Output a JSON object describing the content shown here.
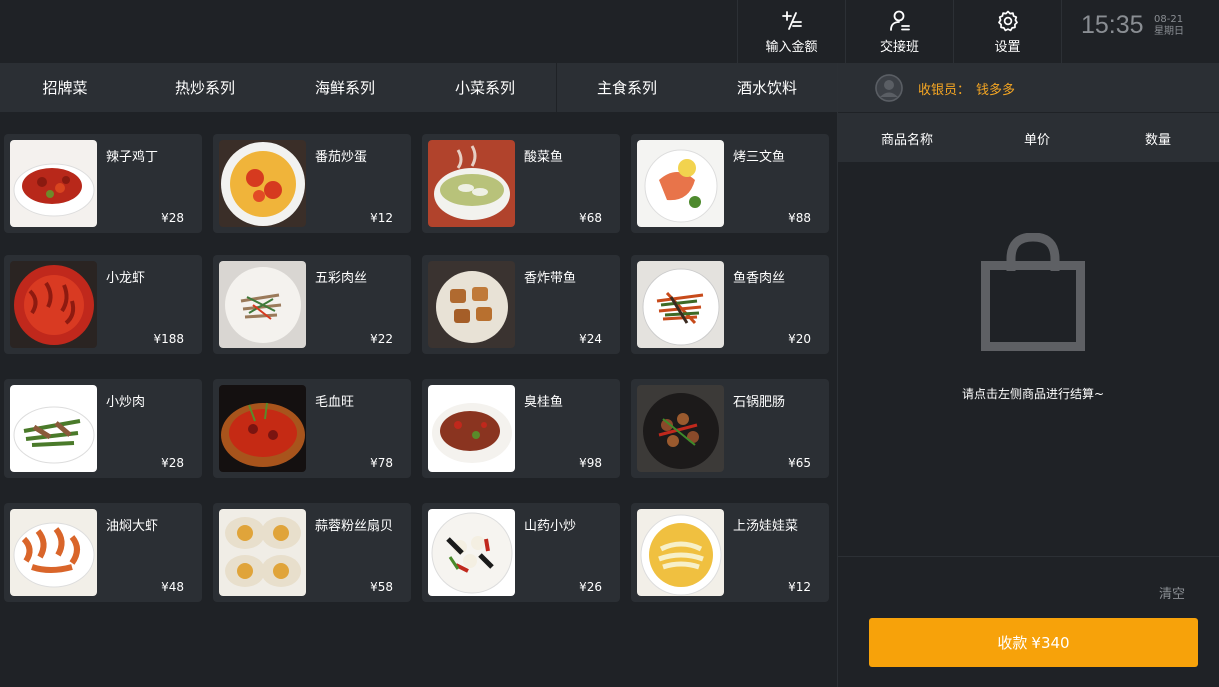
{
  "toolbar": {
    "input_amount": "输入金额",
    "handover": "交接班",
    "settings": "设置"
  },
  "clock": {
    "time": "15:35",
    "date": "08-21",
    "weekday": "星期日"
  },
  "categories": [
    "招牌菜",
    "热炒系列",
    "海鲜系列",
    "小菜系列",
    "主食系列",
    "酒水饮料"
  ],
  "products": [
    {
      "name": "辣子鸡丁",
      "price": "¥28"
    },
    {
      "name": "番茄炒蛋",
      "price": "¥12"
    },
    {
      "name": "酸菜鱼",
      "price": "¥68"
    },
    {
      "name": "烤三文鱼",
      "price": "¥88"
    },
    {
      "name": "小龙虾",
      "price": "¥188"
    },
    {
      "name": "五彩肉丝",
      "price": "¥22"
    },
    {
      "name": "香炸带鱼",
      "price": "¥24"
    },
    {
      "name": "鱼香肉丝",
      "price": "¥20"
    },
    {
      "name": "小炒肉",
      "price": "¥28"
    },
    {
      "name": "毛血旺",
      "price": "¥78"
    },
    {
      "name": "臭桂鱼",
      "price": "¥98"
    },
    {
      "name": "石锅肥肠",
      "price": "¥65"
    },
    {
      "name": "油焖大虾",
      "price": "¥48"
    },
    {
      "name": "蒜蓉粉丝扇贝",
      "price": "¥58"
    },
    {
      "name": "山药小炒",
      "price": "¥26"
    },
    {
      "name": "上汤娃娃菜",
      "price": "¥12"
    }
  ],
  "cashier": {
    "label": "收银员：",
    "name": "钱多多"
  },
  "order_table": {
    "headers": [
      "商品名称",
      "单价",
      "数量"
    ]
  },
  "empty_message": "请点击左侧商品进行结算~",
  "clear_label": "清空",
  "checkout": {
    "label": "收款",
    "amount": "¥340"
  },
  "colors": {
    "accent": "#f7a20a",
    "cashier_text": "#f5a623",
    "background": "#1f2226",
    "panel": "#2b2f34"
  }
}
